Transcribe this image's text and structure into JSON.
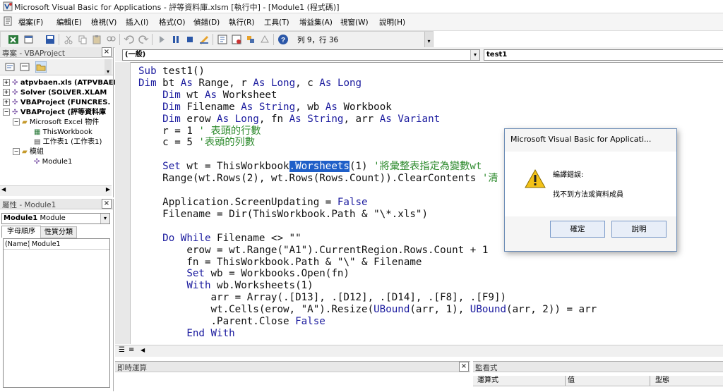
{
  "window": {
    "title": "Microsoft Visual Basic for Applications - 評等資料庫.xlsm [執行中] - [Module1 (程式碼)]"
  },
  "menu": [
    "檔案(F)",
    "編輯(E)",
    "檢視(V)",
    "插入(I)",
    "格式(O)",
    "偵錯(D)",
    "執行(R)",
    "工具(T)",
    "增益集(A)",
    "視窗(W)",
    "說明(H)"
  ],
  "toolbar": {
    "position_text": "列 9，行 36"
  },
  "project": {
    "title": "專案 - VBAProject",
    "items": [
      "atpvbaen.xls (ATPVBAEN",
      "Solver (SOLVER.XLAM",
      "VBAProject (FUNCRES.",
      "VBAProject (評等資料庫",
      "Microsoft Excel 物件",
      "ThisWorkbook",
      "工作表1 (工作表1)",
      "模組",
      "Module1"
    ]
  },
  "properties": {
    "title": "屬性 - Module1",
    "object_name": "Module1",
    "object_type": "Module",
    "tab_alpha": "字母順序",
    "tab_category": "性質分類",
    "row_name": "(Name)",
    "row_value": "Module1"
  },
  "code_window": {
    "object_combo": "(一般)",
    "proc_combo": "test1"
  },
  "bottom": {
    "immediate_title": "即時運算",
    "watch_title": "監看式",
    "watch_cols": [
      "運算式",
      "值",
      "型態"
    ]
  },
  "dialog": {
    "title": "Microsoft Visual Basic for Applicati...",
    "message1": "編譯錯誤:",
    "message2": "找不到方法或資料成員",
    "ok": "確定",
    "help": "說明"
  },
  "colors": {
    "keyword": "#1a1a9e",
    "comment": "#2e8b2e",
    "selection": "#1f5fc8"
  }
}
